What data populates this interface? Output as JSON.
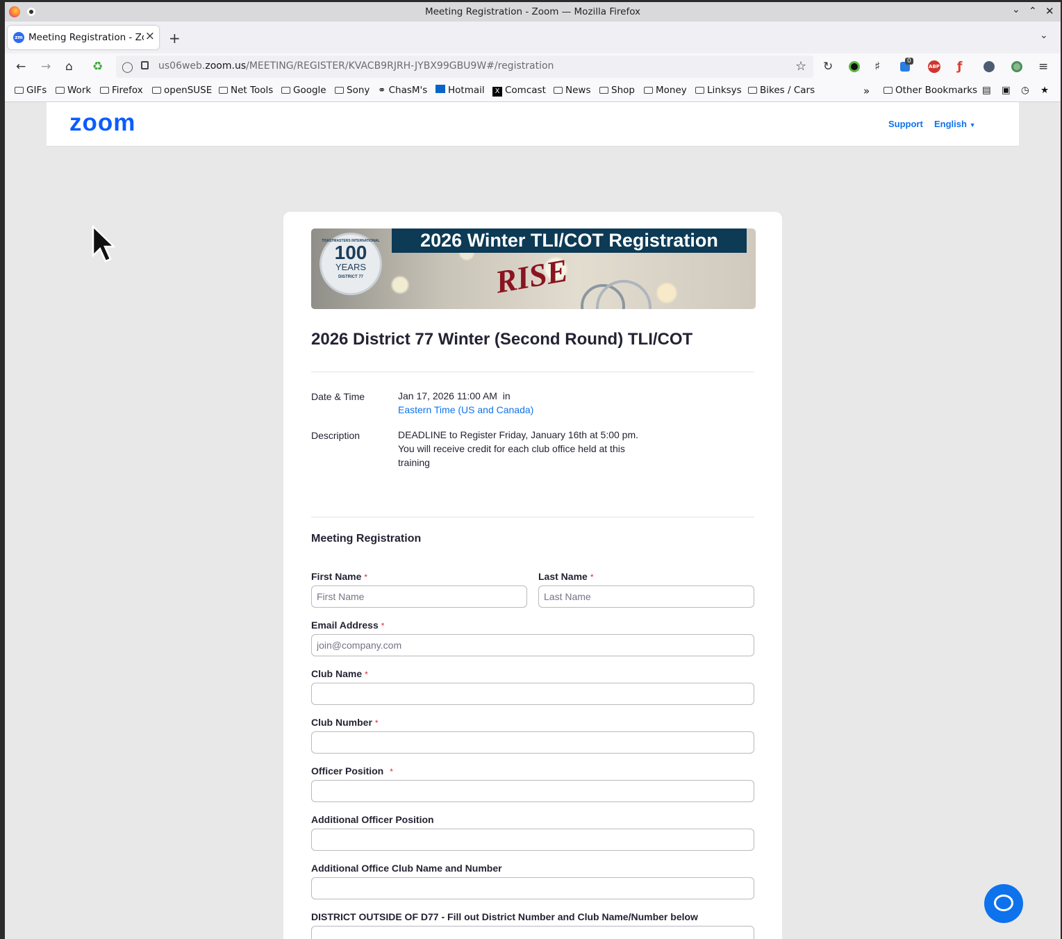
{
  "window": {
    "title": "Meeting Registration - Zoom — Mozilla Firefox"
  },
  "tab": {
    "title": "Meeting Registration - Zoom",
    "favicon": "zm"
  },
  "navbar": {
    "url_prefix": "us06web.",
    "url_domain": "zoom.us",
    "url_path": "/MEETING/REGISTER/KVACB9RJRH-JYBX99GBU9W#/registration",
    "badge_count": "0",
    "abp": "ABP"
  },
  "bookmarks": [
    "GIFs",
    "Work",
    "Firefox",
    "openSUSE",
    "Net Tools",
    "Google",
    "Sony",
    "ChasM's",
    "Hotmail",
    "Comcast",
    "News",
    "Shop",
    "Money",
    "Linksys",
    "Bikes / Cars"
  ],
  "other_bookmarks": "Other Bookmarks",
  "zoom": {
    "logo": "zoom",
    "support": "Support",
    "language": "English"
  },
  "banner": {
    "title": "2026 Winter TLI/COT Registration",
    "badge_number": "100",
    "badge_word": "YEARS",
    "badge_top": "TOASTMASTERS INTERNATIONAL",
    "badge_bottom": "DISTRICT 77",
    "rise": "RISE"
  },
  "meeting": {
    "title": "2026 District 77 Winter (Second Round) TLI/COT",
    "date_label": "Date & Time",
    "date_value": "Jan 17, 2026 11:00 AM  in",
    "timezone": "Eastern Time (US and Canada)",
    "desc_label": "Description",
    "desc_line1": "DEADLINE to Register Friday, January 16th at 5:00 pm.",
    "desc_line2": "You will receive credit for each club office held at this",
    "desc_line3": "training"
  },
  "form": {
    "section": "Meeting Registration",
    "required_mark": "*",
    "first_name": {
      "label": "First Name",
      "placeholder": "First Name"
    },
    "last_name": {
      "label": "Last Name",
      "placeholder": "Last Name"
    },
    "email": {
      "label": "Email Address",
      "placeholder": "join@company.com"
    },
    "club_name": {
      "label": "Club Name"
    },
    "club_number": {
      "label": "Club Number"
    },
    "officer_position": {
      "label": "Officer Position"
    },
    "additional_position": {
      "label": "Additional Officer Position"
    },
    "additional_club": {
      "label": "Additional Office Club Name and Number"
    },
    "district_outside": {
      "label": "DISTRICT OUTSIDE OF D77 - Fill out District Number and Club Name/Number below"
    }
  },
  "colors": {
    "accent": "#0e72ed",
    "zoom_blue": "#0b5cff",
    "required": "#e02828",
    "banner_navy": "#0d3a55"
  }
}
